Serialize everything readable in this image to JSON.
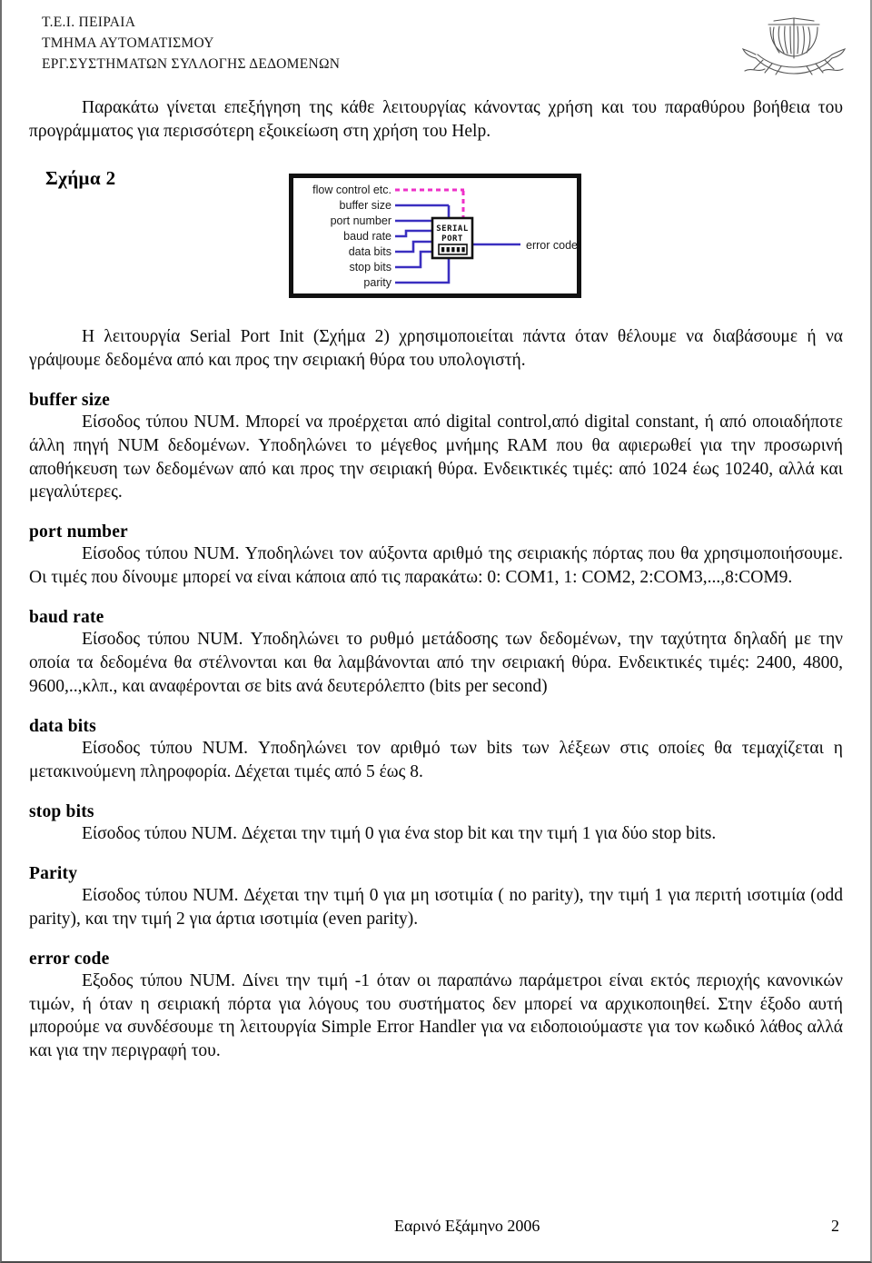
{
  "header": {
    "line1": "Τ.Ε.Ι. ΠΕΙΡΑΙΑ",
    "line2": "ΤΜΗΜΑ ΑΥΤΟΜΑΤΙΣΜΟΥ",
    "line3": "ΕΡΓ.ΣΥΣΤΗΜΑΤΩΝ ΣΥΛΛΟΓΗΣ ΔΕΔΟΜΕΝΩΝ",
    "logo_name": "sailing-ship-logo"
  },
  "intro": {
    "paragraph": "Παρακάτω γίνεται επεξήγηση της κάθε λειτουργίας κάνοντας χρήση και του παραθύρου βοήθεια του προγράμματος για περισσότερη εξοικείωση στη χρήση του Help."
  },
  "figure": {
    "label": "Σχήμα 2",
    "icon_title_line1": "SERIAL",
    "icon_title_line2": "PORT",
    "inputs": [
      "flow control etc.",
      "buffer size",
      "port number",
      "baud rate",
      "data bits",
      "stop bits",
      "parity"
    ],
    "outputs": [
      "error code"
    ],
    "wire_color_data": "#3a2fc0",
    "wire_color_cluster": "#ee30c8",
    "border_color": "#111111"
  },
  "serial_intro": {
    "paragraph": "Η λειτουργία Serial Port Init (Σχήμα 2) χρησιμοποιείται πάντα όταν θέλουμε να διαβάσουμε ή να γράψουμε δεδομένα από και προς την σειριακή θύρα του υπολογιστή."
  },
  "sections": [
    {
      "heading": "buffer size",
      "body": "Είσοδος τύπου NUM. Μπορεί να προέρχεται από digital control,από digital constant, ή από οποιαδήποτε άλλη πηγή NUM δεδομένων. Υποδηλώνει το μέγεθος μνήμης RAM που θα αφιερωθεί για την προσωρινή αποθήκευση των δεδομένων από και προς την σειριακή θύρα. Ενδεικτικές τιμές: από 1024 έως 10240, αλλά και μεγαλύτερες."
    },
    {
      "heading": "port number",
      "body": "Είσοδος τύπου NUM. Υποδηλώνει τον αύξοντα αριθμό της σειριακής πόρτας που θα χρησιμοποιήσουμε. Οι τιμές που δίνουμε μπορεί να είναι κάποια από τις παρακάτω: 0: COM1, 1: COM2, 2:COM3,...,8:COM9."
    },
    {
      "heading": "baud rate",
      "body": "Είσοδος τύπου NUM. Υποδηλώνει το ρυθμό μετάδοσης των δεδομένων, την ταχύτητα δηλαδή με την οποία τα δεδομένα θα στέλνονται και θα λαμβάνονται από την σειριακή θύρα. Ενδεικτικές τιμές: 2400, 4800, 9600,..,κλπ., και αναφέρονται σε bits ανά δευτερόλεπτο (bits per second)"
    },
    {
      "heading": "data bits",
      "body": "Είσοδος τύπου NUM. Υποδηλώνει τον αριθμό των bits των λέξεων στις οποίες θα τεμαχίζεται η μετακινούμενη πληροφορία. Δέχεται τιμές από 5 έως 8."
    },
    {
      "heading": "stop bits",
      "body": "Είσοδος τύπου NUM. Δέχεται την τιμή 0 για ένα stop bit και την τιμή 1 για δύο stop bits."
    },
    {
      "heading": "Parity",
      "body": "Είσοδος τύπου NUM. Δέχεται την τιμή 0 για μη ισοτιμία ( no parity), την τιμή 1 για περιτή ισοτιμία (odd parity), και την τιμή 2 για άρτια ισοτιμία (even parity)."
    },
    {
      "heading": "error code",
      "body": "Εξοδος τύπου NUM. Δίνει την τιμή -1 όταν οι παραπάνω παράμετροι είναι εκτός περιοχής κανονικών τιμών, ή όταν η σειριακή πόρτα για λόγους του συστήματος δεν μπορεί να αρχικοποιηθεί. Στην έξοδο αυτή μπορούμε να συνδέσουμε τη λειτουργία Simple Error Handler για να ειδοποιούμαστε για τον κωδικό λάθος αλλά και για την περιγραφή του."
    }
  ],
  "footer": {
    "semester": "Εαρινό Εξάμηνο 2006",
    "page_number": "2"
  }
}
